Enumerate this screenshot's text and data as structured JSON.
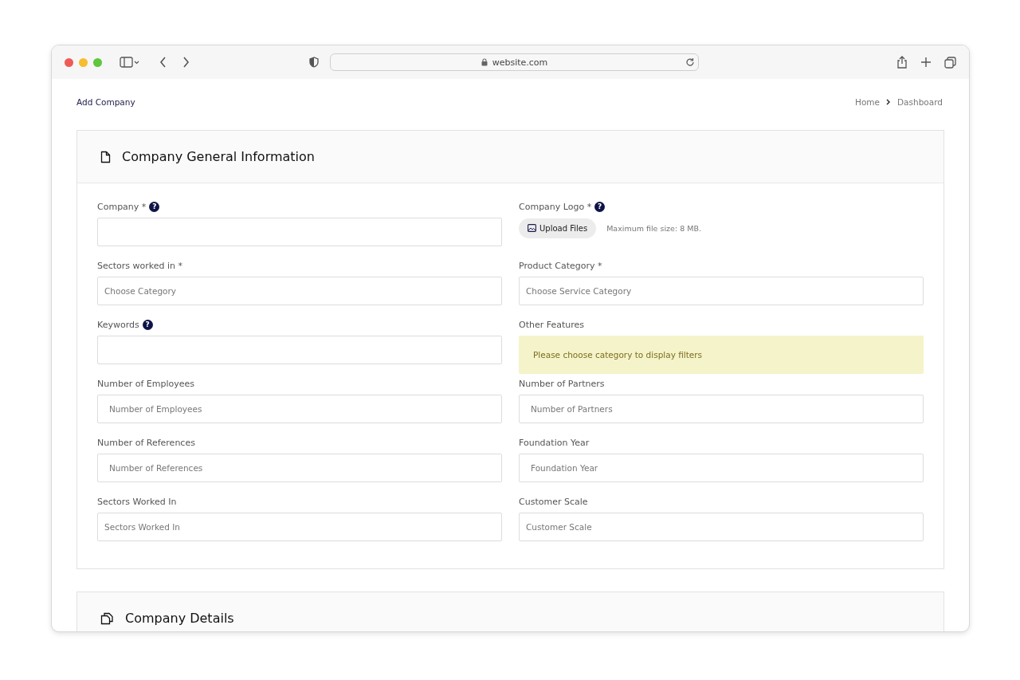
{
  "browser": {
    "url": "website.com"
  },
  "page": {
    "title": "Add Company",
    "breadcrumb": [
      {
        "label": "Home"
      },
      {
        "label": "Dashboard"
      }
    ]
  },
  "sections": [
    {
      "title": "Company General Information",
      "fields": [
        {
          "kind": "input",
          "label": "Company *",
          "help": "?"
        },
        {
          "kind": "upload",
          "label": "Company Logo *",
          "help": "?",
          "button": "Upload Files",
          "note": "Maximum file size: 8 MB."
        },
        {
          "kind": "select",
          "label": "Sectors worked in *",
          "placeholder": "Choose Category"
        },
        {
          "kind": "select",
          "label": "Product Category *",
          "placeholder": "Choose Service Category"
        },
        {
          "kind": "input",
          "label": "Keywords",
          "help": "?"
        },
        {
          "kind": "notice",
          "label": "Other Features",
          "message": "Please choose category to display filters"
        },
        {
          "kind": "input",
          "label": "Number of Employees",
          "placeholder": "Number of Employees"
        },
        {
          "kind": "input",
          "label": "Number of Partners",
          "placeholder": "Number of Partners"
        },
        {
          "kind": "input",
          "label": "Number of References",
          "placeholder": "Number of References"
        },
        {
          "kind": "input",
          "label": "Foundation Year",
          "placeholder": "Foundation Year"
        },
        {
          "kind": "select",
          "label": "Sectors Worked In",
          "placeholder": "Sectors Worked In"
        },
        {
          "kind": "select",
          "label": "Customer Scale",
          "placeholder": "Customer Scale"
        }
      ]
    },
    {
      "title": "Company Details"
    }
  ]
}
